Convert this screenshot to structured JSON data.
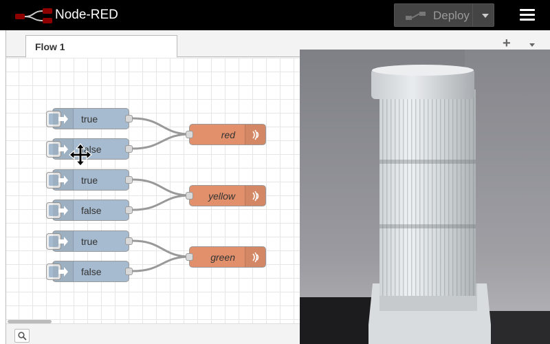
{
  "header": {
    "app_title": "Node-RED",
    "deploy_label": "Deploy",
    "icons": {
      "logo": "node-red-logo",
      "deploy": "deploy-icon",
      "menu": "hamburger-menu-icon"
    }
  },
  "tabs": [
    {
      "label": "Flow 1"
    }
  ],
  "tab_bar": {
    "add_icon": "+",
    "menu_icon": "caret-down-icon"
  },
  "nodes": {
    "inject": [
      {
        "label": "true"
      },
      {
        "label": "false"
      },
      {
        "label": "true"
      },
      {
        "label": "false"
      },
      {
        "label": "true"
      },
      {
        "label": "false"
      }
    ],
    "outputs": [
      {
        "label": "red"
      },
      {
        "label": "yellow"
      },
      {
        "label": "green"
      }
    ]
  },
  "footer": {
    "search_icon": "search-icon"
  },
  "colors": {
    "header_bg": "#000000",
    "inject_node": "#a6bbcf",
    "output_node": "#e2906b",
    "wire": "#999999"
  },
  "camera_feed": {
    "subject": "signal-tower-light"
  }
}
